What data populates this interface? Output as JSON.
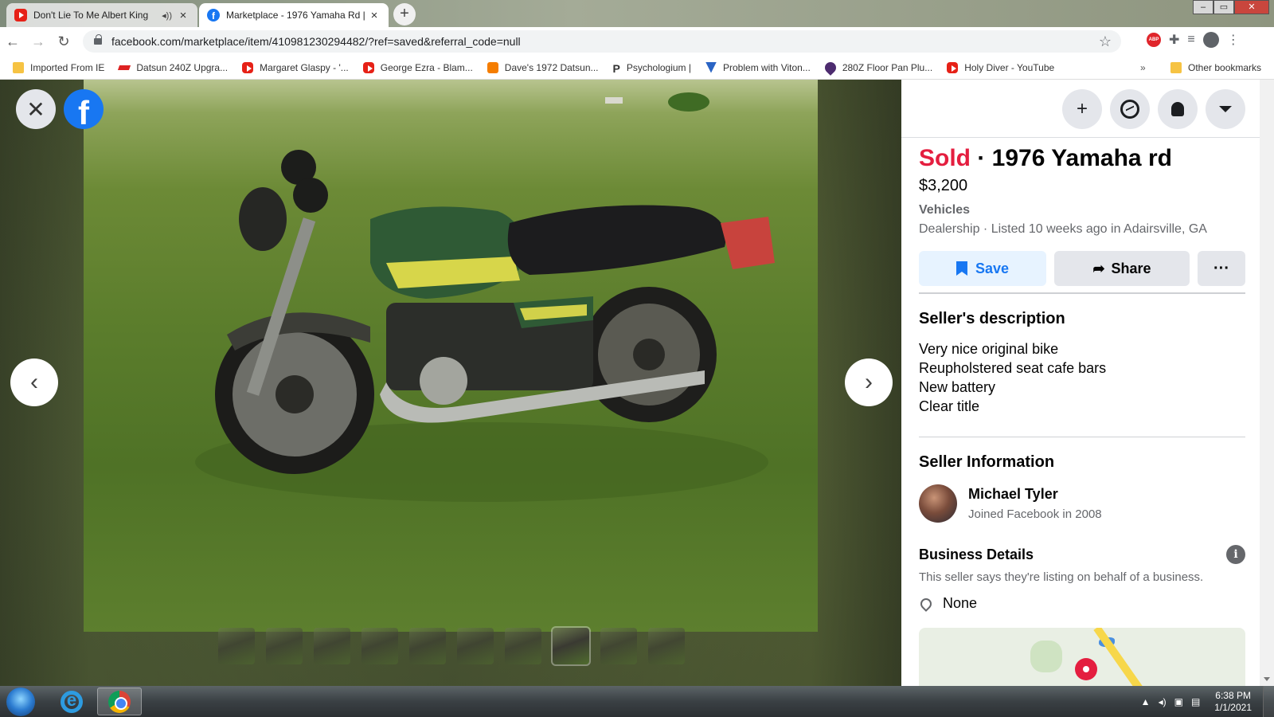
{
  "browser": {
    "tabs": [
      {
        "title": "Don't Lie To Me Albert King",
        "active": false,
        "audio": true
      },
      {
        "title": "Marketplace - 1976 Yamaha Rd |",
        "active": true
      }
    ],
    "url": "facebook.com/marketplace/item/410981230294482/?ref=saved&referral_code=null",
    "bookmarks": [
      {
        "label": "Imported From IE",
        "icon": "folder-icon"
      },
      {
        "label": "Datsun 240Z Upgra...",
        "icon": "datsun-icon"
      },
      {
        "label": "Margaret Glaspy - '...",
        "icon": "youtube-icon"
      },
      {
        "label": "George Ezra - Blam...",
        "icon": "youtube-icon"
      },
      {
        "label": "Dave's 1972 Datsun...",
        "icon": "blogger-icon"
      },
      {
        "label": "Psychologium |",
        "icon": "p-icon"
      },
      {
        "label": "Problem with Viton...",
        "icon": "v-icon"
      },
      {
        "label": "280Z Floor Pan Plu...",
        "icon": "drop-icon"
      },
      {
        "label": "Holy Diver - YouTube",
        "icon": "youtube-icon"
      }
    ],
    "bookmarks_more": "»",
    "other_bookmarks": "Other bookmarks"
  },
  "viewer": {
    "close_glyph": "✕",
    "fb_glyph": "f",
    "prev_glyph": "‹",
    "next_glyph": "›",
    "thumbnail_count": 10,
    "selected_thumbnail": 8
  },
  "listing": {
    "status": "Sold",
    "separator": " · ",
    "title": "1976 Yamaha rd",
    "price": "$3,200",
    "category": "Vehicles",
    "meta": "Dealership · Listed 10 weeks ago in Adairsville, GA",
    "save_label": "Save",
    "share_label": "Share",
    "more_label": "···"
  },
  "description": {
    "heading": "Seller's description",
    "lines": [
      "Very nice original bike",
      "Reupholstered seat cafe bars",
      "New battery",
      "Clear title"
    ]
  },
  "seller": {
    "heading": "Seller Information",
    "name": "Michael Tyler",
    "joined": "Joined Facebook in 2008"
  },
  "business": {
    "heading": "Business Details",
    "note": "This seller says they're listing on behalf of a business.",
    "location": "None",
    "info_glyph": "i"
  },
  "taskbar": {
    "time": "6:38 PM",
    "date": "1/1/2021",
    "ie_glyph": "e"
  },
  "colors": {
    "facebook_blue": "#1877f2",
    "sold_red": "#e41e3f",
    "save_bg": "#e7f3ff"
  }
}
